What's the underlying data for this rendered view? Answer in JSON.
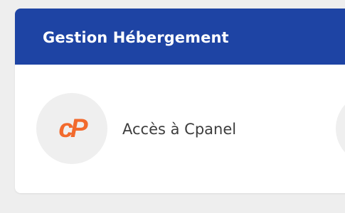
{
  "card": {
    "title": "Gestion Hébergement",
    "header_color": "#1e44a4"
  },
  "items": [
    {
      "label": "Accès à Cpanel",
      "icon": "cpanel-logo-icon",
      "icon_color": "#f26a2d"
    }
  ]
}
